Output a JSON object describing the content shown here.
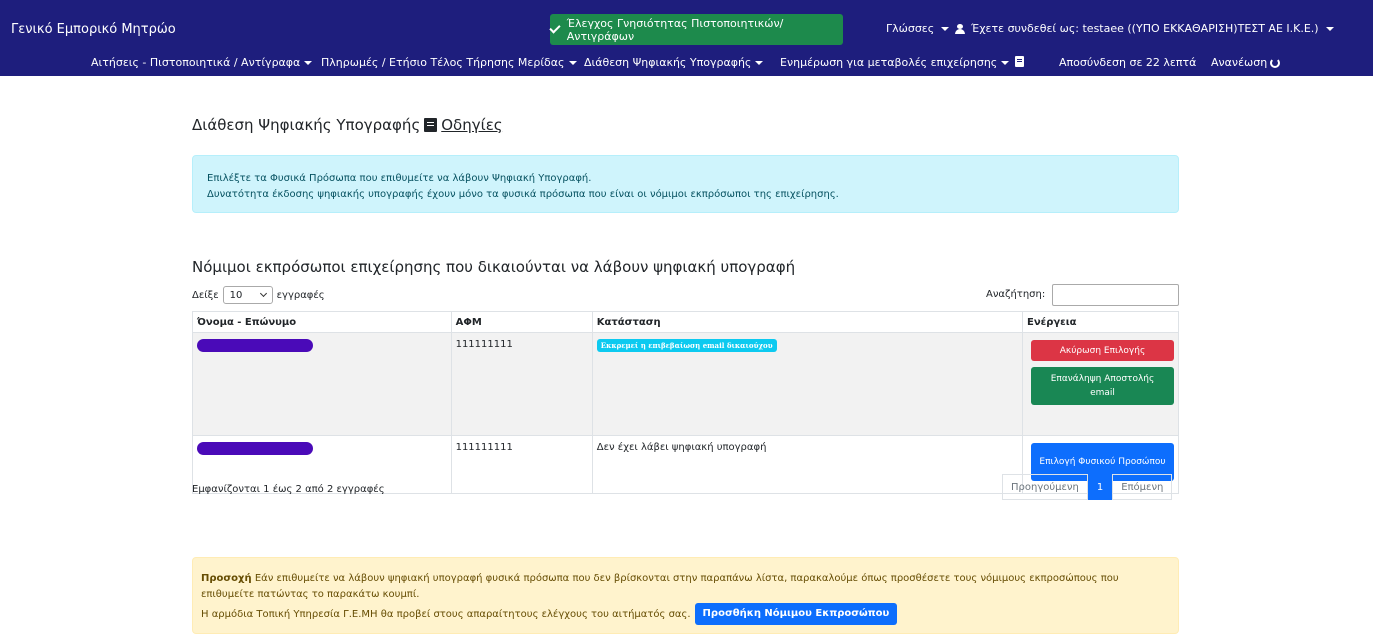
{
  "navbar": {
    "brand": "Γενικό Εμπορικό Μητρώο",
    "verify_button": "Έλεγχος Γνησιότητας Πιστοποιητικών/Αντιγράφων",
    "languages": "Γλώσσες",
    "user": "Έχετε συνδεθεί ως: testaee ((ΥΠΟ ΕΚΚΑΘΑΡΙΣΗ)ΤΕΣΤ ΑΕ Ι.Κ.Ε.)",
    "menu": [
      "Αιτήσεις - Πιστοποιητικά / Αντίγραφα",
      "Πληρωμές / Ετήσιο Τέλος Τήρησης Μερίδας",
      "Διάθεση Ψηφιακής Υπογραφής",
      "Ενημέρωση για μεταβολές επιχείρησης"
    ],
    "logout": "Αποσύνδεση σε 22 λεπτά",
    "refresh": "Ανανέωση"
  },
  "page": {
    "title": "Διάθεση Ψηφιακής Υπογραφής",
    "instructions_link": "Οδηγίες",
    "info_line1": "Επιλέξτε τα Φυσικά Πρόσωπα που επιθυμείτε να λάβουν Ψηφιακή Υπογραφή.",
    "info_line2": "Δυνατότητα έκδοσης ψηφιακής υπογραφής έχουν μόνο τα φυσικά πρόσωπα που είναι οι νόμιμοι εκπρόσωποι της επιχείρησης."
  },
  "reps": {
    "title": "Νόμιμοι εκπρόσωποι επιχείρησης που δικαιούνται να λάβουν ψηφιακή υπογραφή",
    "show_prefix": "Δείξε",
    "page_size": "10",
    "show_suffix": "εγγραφές",
    "search_label": "Αναζήτηση:",
    "search_value": "",
    "columns": [
      "Όνομα - Επώνυμο",
      "ΑΦΜ",
      "Κατάσταση",
      "Ενέργεια"
    ],
    "rows": [
      {
        "afm": "111111111",
        "status_badge": "Εκκρεμεί η επιβεβαίωση email δικαιούχου",
        "action1": "Ακύρωση Επιλογής",
        "action2": "Επανάληψη Αποστολής email"
      },
      {
        "afm": "111111111",
        "status_text": "Δεν έχει λάβει ψηφιακή υπογραφή",
        "action1": "Επιλογή Φυσικού Προσώπου"
      }
    ],
    "info_count": "Εμφανίζονται 1 έως 2 από 2 εγγραφές",
    "pager": {
      "prev": "Προηγούμενη",
      "current": "1",
      "next": "Επόμενη"
    }
  },
  "warning": {
    "strong": "Προσοχή",
    "text1": "Εάν επιθυμείτε να λάβουν ψηφιακή υπογραφή φυσικά πρόσωπα που δεν βρίσκονται στην παραπάνω λίστα, παρακαλούμε όπως προσθέσετε τους νόμιμους εκπροσώπους που επιθυμείτε πατώντας το παρακάτω κουμπί.",
    "text2": "Η αρμόδια Τοπική Υπηρεσία Γ.Ε.ΜΗ θα προβεί στους απαραίτητους ελέγχους του αιτήματός σας.",
    "add_button": "Προσθήκη Νόμιμου Εκπροσώπου"
  },
  "colors": {
    "navbar": "#1e1e7d",
    "success": "#198754",
    "danger": "#dc3545",
    "primary": "#0d6efd",
    "info": "#0dcaf0",
    "redaction": "#4a0ab8"
  },
  "icons": [
    "check-icon",
    "user-icon",
    "book-icon",
    "refresh-icon",
    "chevron-down-icon"
  ]
}
